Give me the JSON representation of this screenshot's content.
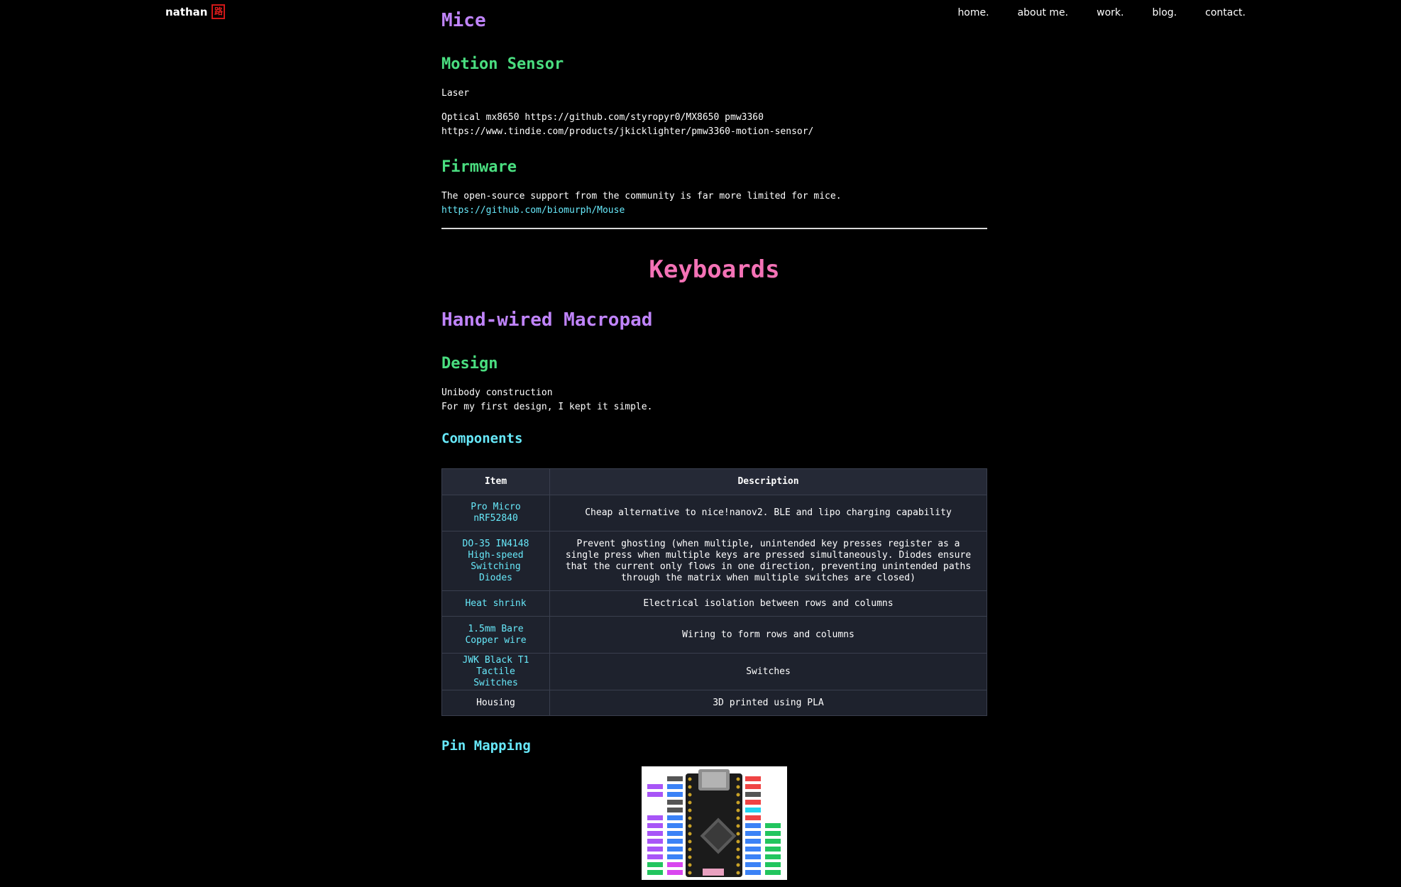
{
  "brand": {
    "name": "nathan",
    "logo_glyph": "路"
  },
  "nav": [
    "home.",
    "about me.",
    "work.",
    "blog.",
    "contact."
  ],
  "mice": {
    "title": "Mice",
    "motion_sensor": {
      "heading": "Motion Sensor",
      "laser": "Laser",
      "optical_line1": "Optical mx8650 https://github.com/styropyr0/MX8650 pmw3360",
      "optical_line2": "https://www.tindie.com/products/jkicklighter/pmw3360-motion-sensor/"
    },
    "firmware": {
      "heading": "Firmware",
      "text": "The open-source support from the community is far more limited for mice.",
      "link": "https://github.com/biomurph/Mouse"
    }
  },
  "keyboards": {
    "title": "Keyboards",
    "macropad": {
      "title": "Hand-wired Macropad",
      "design": {
        "heading": "Design",
        "line1": "Unibody construction",
        "line2": "For my first design, I kept it simple."
      },
      "components": {
        "heading": "Components",
        "headers": [
          "Item",
          "Description"
        ],
        "rows": [
          {
            "item": [
              "Pro Micro",
              "nRF52840"
            ],
            "description": "Cheap alternative to nice!nanov2. BLE and lipo charging capability"
          },
          {
            "item": [
              "DO-35 IN4148",
              "High-speed",
              "Switching Diodes"
            ],
            "description": "Prevent ghosting (when multiple, unintended key presses register as a single press when multiple keys are pressed simultaneously. Diodes ensure that the current only flows in one direction, preventing unintended paths through the matrix when multiple switches are closed)"
          },
          {
            "item": [
              "Heat shrink"
            ],
            "description": "Electrical isolation between rows and columns"
          },
          {
            "item": [
              "1.5mm Bare",
              "Copper wire"
            ],
            "description": "Wiring to form rows and columns"
          },
          {
            "item": [
              "JWK Black T1",
              "Tactile Switches"
            ],
            "description": "Switches"
          },
          {
            "item": [
              "Housing"
            ],
            "description": "3D printed using PLA"
          }
        ]
      },
      "pin_mapping": {
        "heading": "Pin Mapping",
        "image": "pro-micro-nrf52840-pinout-diagram"
      }
    }
  },
  "colors": {
    "background": "#000000",
    "purple_heading": "#c084fc",
    "green_heading": "#4ade80",
    "cyan_heading": "#67e8f9",
    "pink_heading": "#f472b6",
    "table_bg": "#1e222d"
  }
}
